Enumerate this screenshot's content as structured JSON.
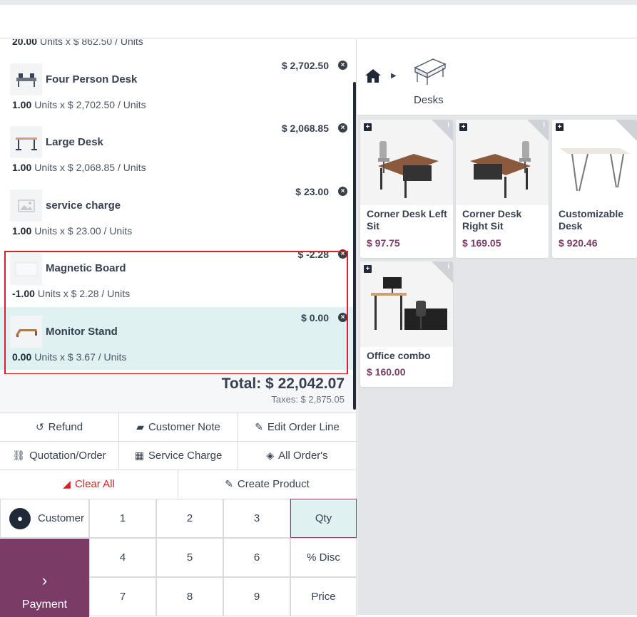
{
  "order": {
    "partial_line": {
      "qty": "20.00",
      "detail": "Units x $ 862.50 / Units"
    },
    "lines": [
      {
        "name": "Four Person Desk",
        "price": "$ 2,702.50",
        "qty": "1.00",
        "detail": "Units x $ 2,702.50 / Units",
        "icon": "desk-icon"
      },
      {
        "name": "Large Desk",
        "price": "$ 2,068.85",
        "qty": "1.00",
        "detail": "Units x $ 2,068.85 / Units",
        "icon": "desk-icon"
      },
      {
        "name": "service charge",
        "price": "$ 23.00",
        "qty": "1.00",
        "detail": "Units x $ 23.00 / Units",
        "icon": "image-placeholder-icon"
      },
      {
        "name": "Magnetic Board",
        "price": "$ -2.28",
        "qty": "-1.00",
        "detail": "Units x $ 2.28 / Units",
        "icon": "board-icon"
      },
      {
        "name": "Monitor Stand",
        "price": "$ 0.00",
        "qty": "0.00",
        "detail": "Units x $ 3.67 / Units",
        "icon": "monitor-stand-icon"
      }
    ],
    "total": "Total: $ 22,042.07",
    "taxes": "Taxes: $ 2,875.05"
  },
  "controls": {
    "refund": "Refund",
    "customer_note": "Customer Note",
    "edit_order_line": "Edit Order Line",
    "quotation_order": "Quotation/Order",
    "service_charge": "Service Charge",
    "all_orders": "All Order's",
    "clear_all": "Clear All",
    "create_product": "Create Product"
  },
  "numpad": {
    "customer": "Customer",
    "payment": "Payment",
    "keys": [
      "1",
      "2",
      "3",
      "Qty",
      "4",
      "5",
      "6",
      "% Disc",
      "7",
      "8",
      "9",
      "Price"
    ],
    "active_mode": "Qty"
  },
  "category": {
    "breadcrumb_home_icon": "home-icon",
    "name": "Desks"
  },
  "products": [
    {
      "name": "Corner Desk Left Sit",
      "price": "$ 97.75"
    },
    {
      "name": "Corner Desk Right Sit",
      "price": "$ 169.05"
    },
    {
      "name": "Customizable Desk (Aluminiu…",
      "price": "$ 920.46"
    },
    {
      "name": "Office combo",
      "price": "$ 160.00"
    }
  ],
  "colors": {
    "accent": "#7a3b67",
    "selected_line": "#e0f1f1",
    "danger": "#d92027"
  }
}
